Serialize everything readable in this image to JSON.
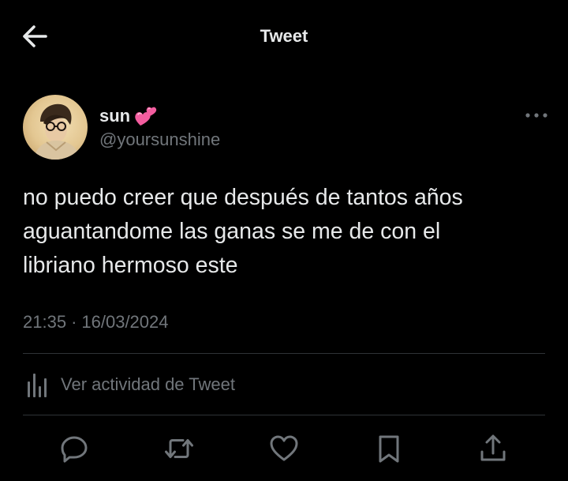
{
  "header": {
    "title": "Tweet",
    "back_icon": "arrow-left-icon"
  },
  "tweet": {
    "author": {
      "display_name": "sun",
      "name_emoji": "two-hearts-emoji",
      "handle": "@yoursunshine"
    },
    "text": "no puedo creer que después de tantos años\naguantandome las ganas se me de con el\nlibriano hermoso este",
    "time": "21:35",
    "separator": "·",
    "date": "16/03/2024"
  },
  "activity": {
    "label": "Ver actividad de Tweet",
    "icon": "analytics-icon"
  },
  "actions": [
    {
      "name": "reply",
      "icon": "reply-bubble-icon"
    },
    {
      "name": "retweet",
      "icon": "retweet-icon"
    },
    {
      "name": "like",
      "icon": "heart-icon"
    },
    {
      "name": "bookmark",
      "icon": "bookmark-icon"
    },
    {
      "name": "share",
      "icon": "share-icon"
    }
  ],
  "colors": {
    "background": "#000000",
    "primary_text": "#e7e9ea",
    "secondary_text": "#71767b",
    "divider": "#2f3336",
    "emoji_pink": "#f35d9f"
  }
}
